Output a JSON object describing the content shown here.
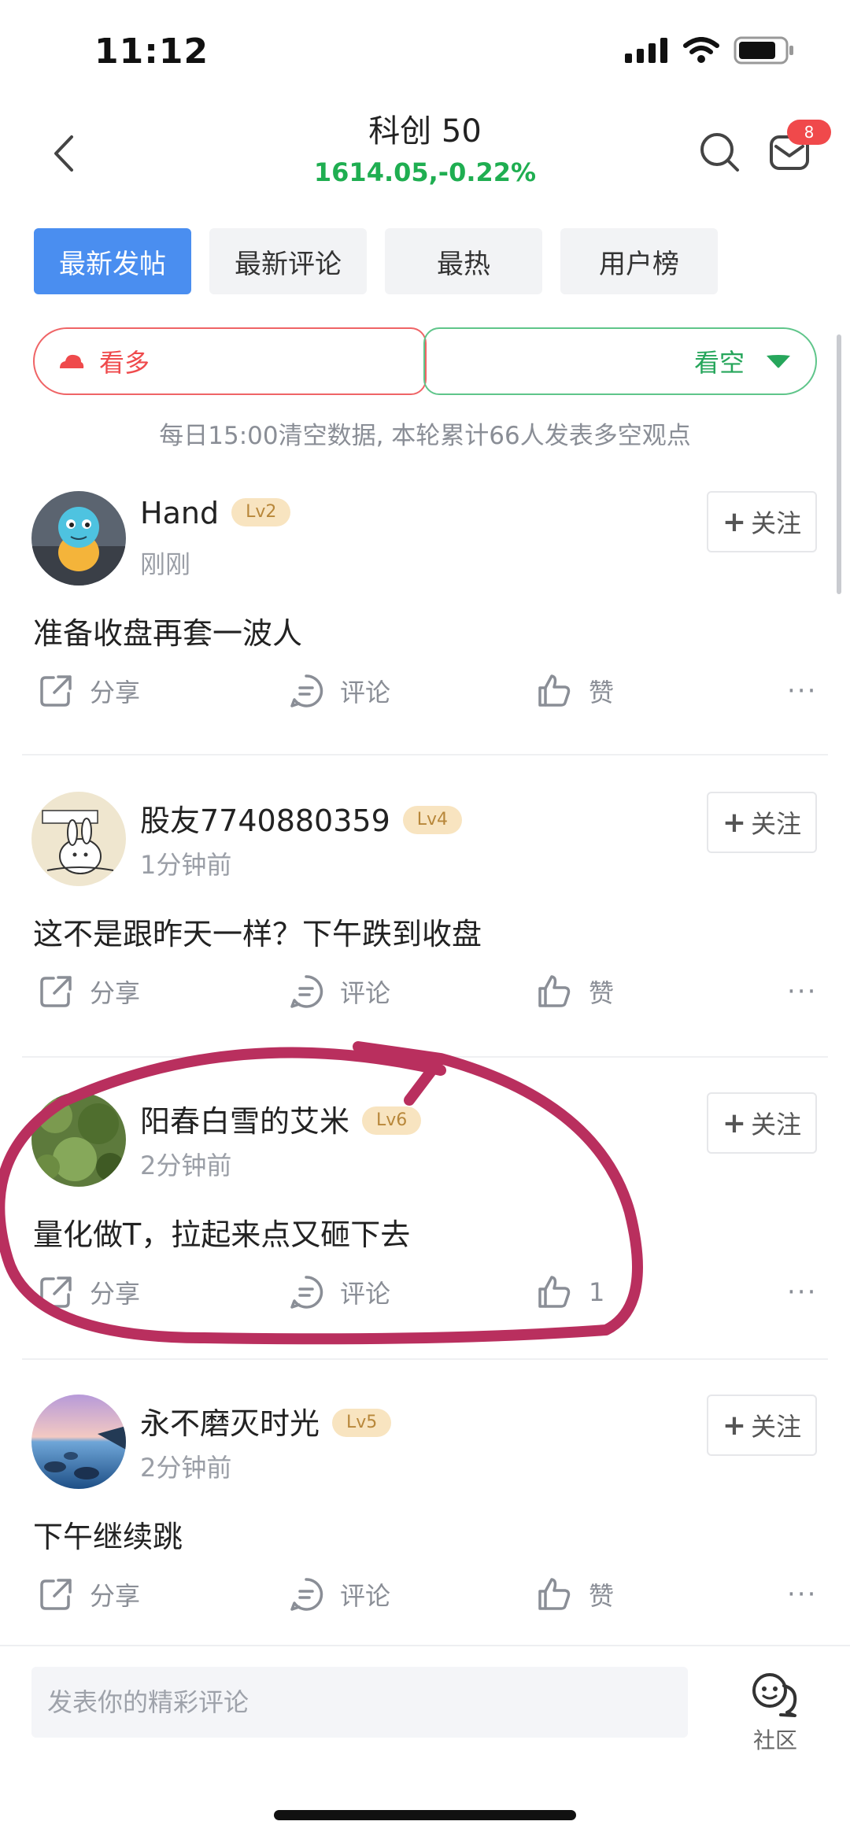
{
  "status_bar": {
    "time": "11:12"
  },
  "header": {
    "title": "科创 50",
    "quote": "1614.05,-0.22%",
    "message_badge": "8",
    "quote_color": "#1fae51"
  },
  "tabs": [
    {
      "label": "最新发帖",
      "active": true
    },
    {
      "label": "最新评论",
      "active": false
    },
    {
      "label": "最热",
      "active": false
    },
    {
      "label": "用户榜",
      "active": false
    }
  ],
  "sentiment": {
    "bull_label": "看多",
    "bear_label": "看空",
    "note": "每日15:00清空数据, 本轮累计66人发表多空观点",
    "bull_color": "#ef4a4c",
    "bear_color": "#26a65b"
  },
  "post_actions": {
    "share": "分享",
    "comment": "评论",
    "like": "赞",
    "more": "···",
    "follow": "关注"
  },
  "posts": [
    {
      "username": "Hand",
      "level": "Lv2",
      "time": "刚刚",
      "content": "准备收盘再套一波人",
      "like_label": "赞",
      "avatar": "squirtle-figure-avatar"
    },
    {
      "username": "股友7740880359",
      "level": "Lv4",
      "time": "1分钟前",
      "content": "这不是跟昨天一样？下午跌到收盘",
      "like_label": "赞",
      "avatar": "cartoon-rabbit-avatar"
    },
    {
      "username": "阳春白雪的艾米",
      "level": "Lv6",
      "time": "2分钟前",
      "content": "量化做T，拉起来点又砸下去",
      "like_label": "1",
      "avatar": "green-leaves-avatar"
    },
    {
      "username": "永不磨灭时光",
      "level": "Lv5",
      "time": "2分钟前",
      "content": "下午继续跳",
      "like_label": "赞",
      "avatar": "seaside-sunset-avatar"
    }
  ],
  "bottom_bar": {
    "comment_placeholder": "发表你的精彩评论",
    "community_label": "社区"
  }
}
